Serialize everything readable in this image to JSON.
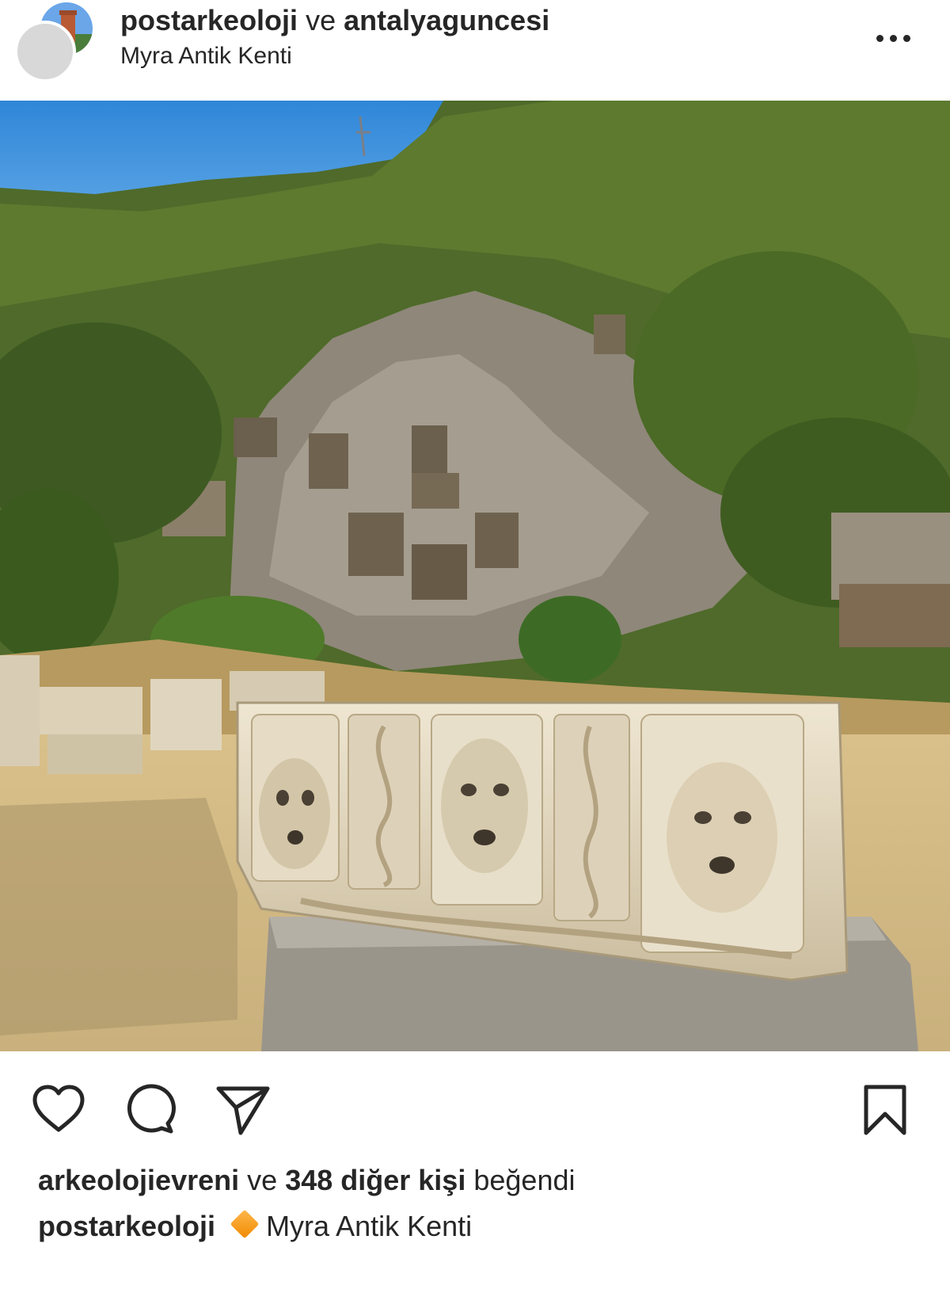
{
  "post": {
    "author_primary": "postarkeoloji",
    "collab_joiner": "ve",
    "author_secondary": "antalyaguncesi",
    "location": "Myra Antik Kenti"
  },
  "likes": {
    "first_liker": "arkeolojievreni",
    "joiner": "ve",
    "others": "348 diğer kişi",
    "suffix": "beğendi"
  },
  "caption": {
    "username": "postarkeoloji",
    "emoji": "orange-diamond-icon",
    "text": "Myra Antik Kenti"
  },
  "colors": {
    "text": "#262626",
    "sky": "#3f8fdc",
    "tag_button": "#4d4d4d"
  }
}
